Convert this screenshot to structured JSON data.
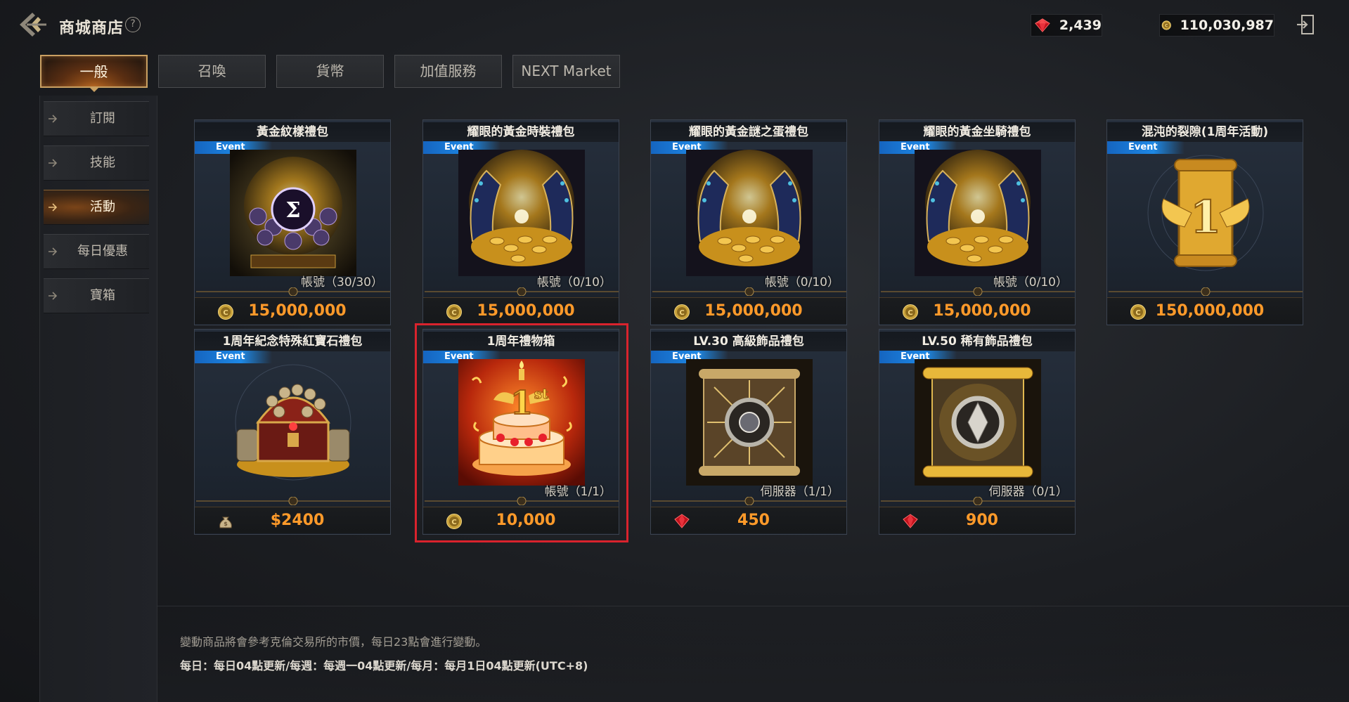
{
  "header": {
    "title": "商城商店",
    "help_symbol": "?",
    "ruby_balance": "2,439",
    "gold_balance": "110,030,987"
  },
  "tabs": [
    {
      "label": "一般",
      "active": true
    },
    {
      "label": "召喚",
      "active": false
    },
    {
      "label": "貨幣",
      "active": false
    },
    {
      "label": "加值服務",
      "active": false
    },
    {
      "label": "NEXT Market",
      "active": false
    }
  ],
  "sidebar": {
    "items": [
      {
        "label": "訂閱",
        "active": false
      },
      {
        "label": "技能",
        "active": false
      },
      {
        "label": "活動",
        "active": true
      },
      {
        "label": "每日優惠",
        "active": false
      },
      {
        "label": "寶箱",
        "active": false
      }
    ]
  },
  "products": [
    {
      "title": "黃金紋樣禮包",
      "tag": "Event",
      "limit": "帳號（30/30）",
      "price": "15,000,000",
      "currency": "gold",
      "image": "gem-crest-icon"
    },
    {
      "title": "耀眼的黃金時裝禮包",
      "tag": "Event",
      "limit": "帳號（0/10）",
      "price": "15,000,000",
      "currency": "gold",
      "image": "gold-hoard-icon"
    },
    {
      "title": "耀眼的黃金謎之蛋禮包",
      "tag": "Event",
      "limit": "帳號（0/10）",
      "price": "15,000,000",
      "currency": "gold",
      "image": "gold-hoard-icon"
    },
    {
      "title": "耀眼的黃金坐騎禮包",
      "tag": "Event",
      "limit": "帳號（0/10）",
      "price": "15,000,000",
      "currency": "gold",
      "image": "gold-hoard-icon"
    },
    {
      "title": "混沌的裂隙(1周年活動)",
      "tag": "Event",
      "limit": "",
      "price": "150,000,000",
      "currency": "gold",
      "image": "winged-scroll-icon"
    },
    {
      "title": "1周年紀念特殊紅寶石禮包",
      "tag": "Event",
      "limit": "",
      "price": "$2400",
      "currency": "cash",
      "image": "treasure-chest-icon"
    },
    {
      "title": "1周年禮物箱",
      "tag": "Event",
      "limit": "帳號（1/1）",
      "price": "10,000",
      "currency": "gold",
      "image": "birthday-cake-icon"
    },
    {
      "title": "LV.30 高級飾品禮包",
      "tag": "Event",
      "limit": "伺服器（1/1）",
      "price": "450",
      "currency": "ruby",
      "image": "ring-scroll-icon"
    },
    {
      "title": "LV.50 稀有飾品禮包",
      "tag": "Event",
      "limit": "伺服器（0/1）",
      "price": "900",
      "currency": "ruby",
      "image": "ring-scroll-gold-icon"
    }
  ],
  "notes": {
    "line1": "變動商品將會參考克倫交易所的市價，每日23點會進行變動。",
    "line2": "每日：每日04點更新/每週：每週一04點更新/每月：每月1日04點更新(UTC+8)"
  },
  "colors": {
    "accent": "#c9a062",
    "price": "#ff9a2a",
    "event_tag": "#1e88e5",
    "highlight": "#d9232d"
  }
}
